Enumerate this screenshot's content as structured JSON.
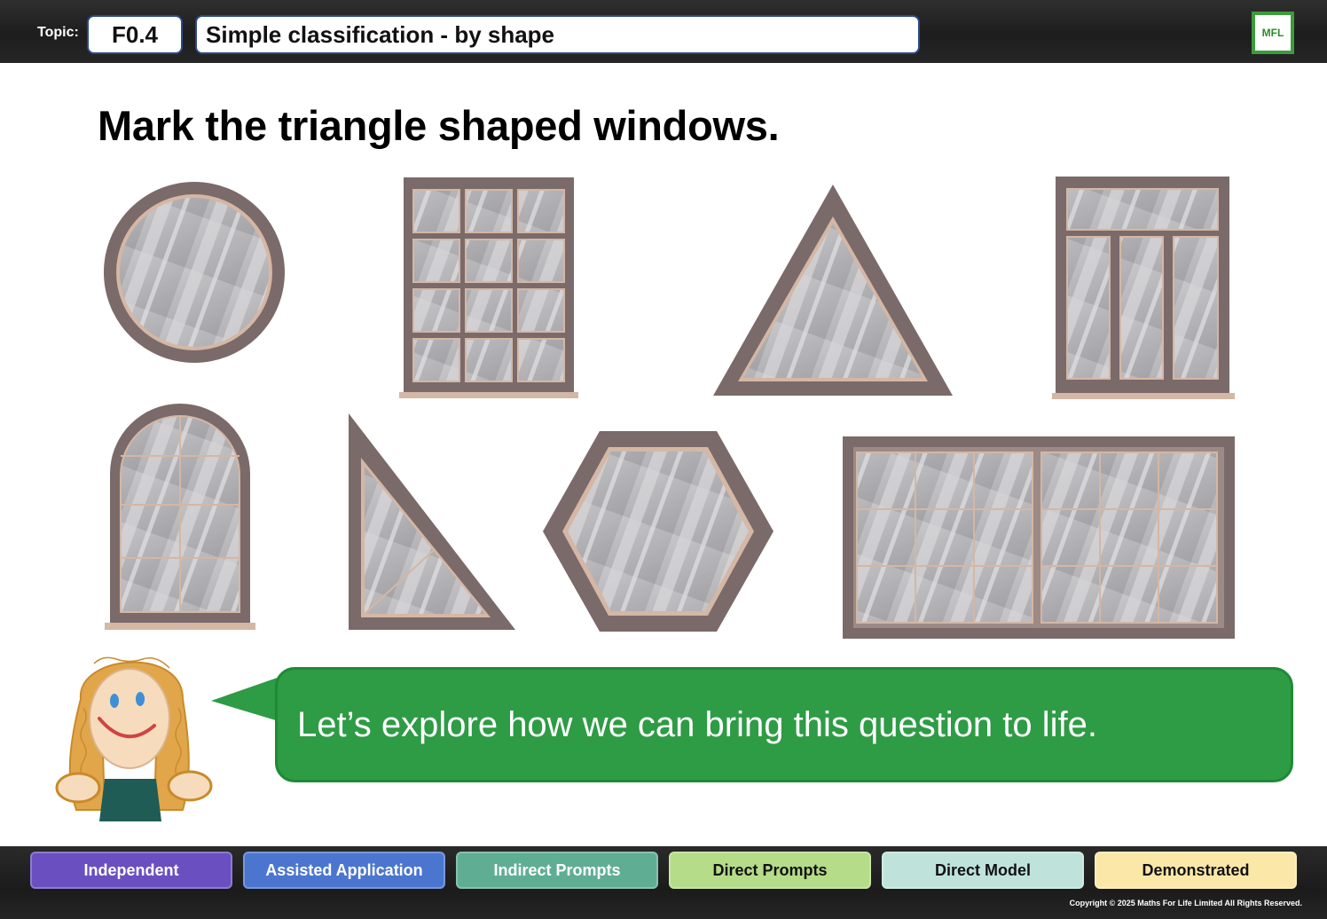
{
  "header": {
    "topic_label": "Topic:",
    "topic_code": "F0.4",
    "topic_title": "Simple classification - by shape",
    "logo_text": "MFL"
  },
  "question": "Mark the triangle shaped windows.",
  "windows": [
    {
      "shape": "circle",
      "icon": "circle-window"
    },
    {
      "shape": "rectangle",
      "icon": "grid-window"
    },
    {
      "shape": "triangle",
      "icon": "triangle-window"
    },
    {
      "shape": "rectangle",
      "icon": "transom-window"
    },
    {
      "shape": "arch",
      "icon": "arched-window"
    },
    {
      "shape": "triangle",
      "icon": "right-triangle-window"
    },
    {
      "shape": "hexagon",
      "icon": "hexagon-window"
    },
    {
      "shape": "rectangle",
      "icon": "wide-window"
    }
  ],
  "speech": "Let’s explore how we can bring this question to life.",
  "levels": [
    {
      "label": "Independent",
      "bg": "#6a4fc0",
      "fg": "#ffffff"
    },
    {
      "label": "Assisted Application",
      "bg": "#4b76d0",
      "fg": "#ffffff"
    },
    {
      "label": "Indirect Prompts",
      "bg": "#5fae94",
      "fg": "#ffffff"
    },
    {
      "label": "Direct Prompts",
      "bg": "#b5dc88",
      "fg": "#111111"
    },
    {
      "label": "Direct Model",
      "bg": "#bfe3da",
      "fg": "#111111"
    },
    {
      "label": "Demonstrated",
      "bg": "#fbe8a8",
      "fg": "#111111"
    }
  ],
  "copyright": "Copyright © 2025 Maths For Life Limited All Rights Reserved.",
  "colors": {
    "frame": "#7b6a6a",
    "frame_light": "#d4b7a4",
    "glass": "#aeadb0",
    "bubble": "#2e9b45"
  }
}
